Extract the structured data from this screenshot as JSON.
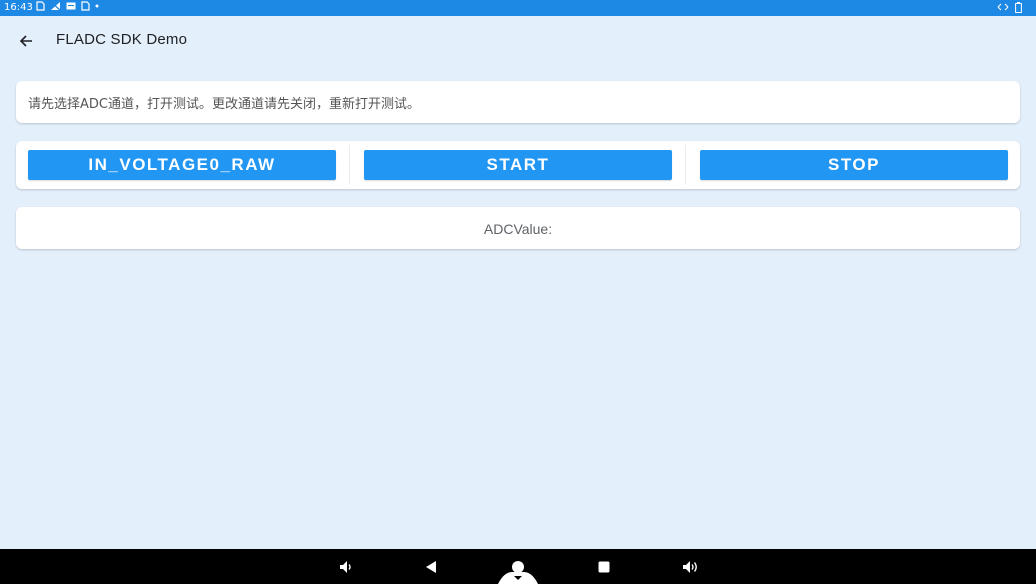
{
  "status_bar": {
    "time": "16:43",
    "left_icons": [
      "sim-icon",
      "signal-off-icon",
      "message-icon",
      "sim-icon",
      "dot-icon"
    ],
    "right_icons": [
      "data-arrows-icon",
      "battery-icon"
    ]
  },
  "app_bar": {
    "title": "FLADC SDK Demo",
    "back_icon": "arrow-left-icon"
  },
  "info_card": {
    "message": "请先选择ADC通道，打开测试。更改通道请先关闭，重新打开测试。"
  },
  "buttons": {
    "channel_label": "IN_VOLTAGE0_RAW",
    "start_label": "START",
    "stop_label": "STOP"
  },
  "value_card": {
    "label": "ADCValue:"
  },
  "nav_bar": {
    "icons": [
      "volume-down-icon",
      "back-triangle-icon",
      "home-circle-icon",
      "recents-square-icon",
      "volume-up-icon"
    ]
  },
  "colors": {
    "status_bar": "#1e88e5",
    "background": "#e3effb",
    "button": "#2196f3",
    "nav_bar": "#000000"
  }
}
